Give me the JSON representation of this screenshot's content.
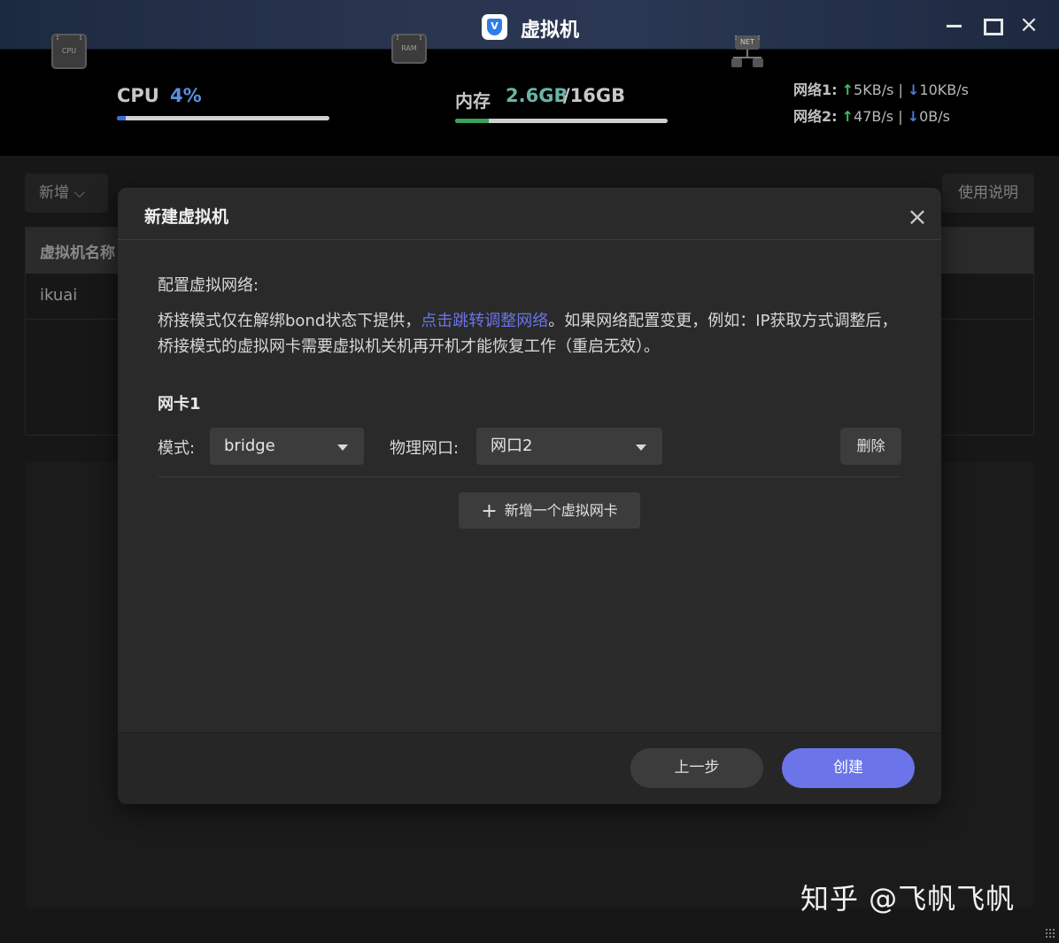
{
  "window": {
    "title": "虚拟机",
    "logo_letter": "V"
  },
  "stats": {
    "cpu": {
      "label": "CPU",
      "value": "4%",
      "usage_fraction": 0.04
    },
    "memory": {
      "label": "内存",
      "used": "2.6GB",
      "separator": "/",
      "total": "16GB",
      "usage_fraction": 0.16
    },
    "icons": {
      "cpu": "CPU",
      "ram": "RAM",
      "net": "NET"
    },
    "network": [
      {
        "label": "网络1:",
        "up_arrow": "↑",
        "up": "5KB/s",
        "sep": "|",
        "down_arrow": "↓",
        "down": "10KB/s"
      },
      {
        "label": "网络2:",
        "up_arrow": "↑",
        "up": "47B/s",
        "sep": "|",
        "down_arrow": "↓",
        "down": "0B/s"
      }
    ]
  },
  "background": {
    "new_button": "新增 ⌵",
    "help_button": "使用说明",
    "table_header": "虚拟机名称",
    "table_row": "ikuai"
  },
  "modal": {
    "title": "新建虚拟机",
    "close": "×",
    "section_label": "配置虚拟网络:",
    "notice_before": "桥接模式仅在解绑bond状态下提供，",
    "notice_link": "点击跳转调整网络",
    "notice_after": "。如果网络配置变更，例如：IP获取方式调整后，桥接模式的虚拟网卡需要虚拟机关机再开机才能恢复工作（重启无效）。",
    "nic": {
      "title": "网卡1",
      "mode_label": "模式:",
      "mode_value": "bridge",
      "port_label": "物理网口:",
      "port_value": "网口2",
      "delete_label": "删除"
    },
    "add_nic_plus": "+",
    "add_nic_label": "新增一个虚拟网卡",
    "prev_button": "上一步",
    "create_button": "创建"
  },
  "watermark": "知乎 @飞帆飞帆",
  "colors": {
    "accent": "#6b74e8",
    "cpu_bar": "#3a6fd0",
    "mem_bar": "#3aa05a",
    "up_arrow": "#3cc06a",
    "down_arrow": "#4a7de0"
  }
}
